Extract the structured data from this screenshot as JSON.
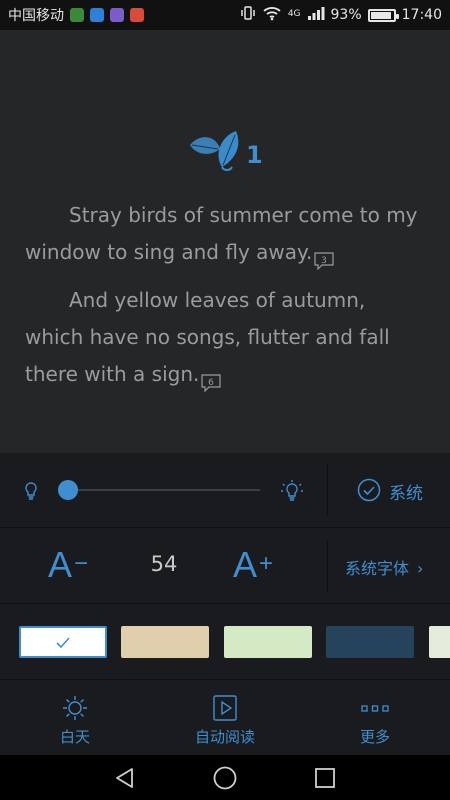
{
  "status_bar": {
    "carrier": "中国移动",
    "signal_type": "4G",
    "battery": "93%",
    "battery_level": 0.93,
    "time": "17:40"
  },
  "reader": {
    "chapter_number": "1",
    "paragraphs": [
      "Stray birds of summer come to my window to sing and fly away.",
      "And yellow leaves of autumn, which have no songs, flutter and fall there with a sign."
    ],
    "note_counts": [
      "3",
      "6"
    ]
  },
  "settings": {
    "brightness_level": 0.02,
    "system_brightness_label": "系统",
    "font_decrease_label": "A",
    "font_increase_label": "A",
    "font_size": "54",
    "system_font_label": "系统字体",
    "themes": [
      {
        "name": "white",
        "color": "#ffffff",
        "selected": true
      },
      {
        "name": "beige",
        "color": "#dfcfac",
        "selected": false
      },
      {
        "name": "green",
        "color": "#d3eac4",
        "selected": false
      },
      {
        "name": "navy",
        "color": "#25445c",
        "selected": false
      },
      {
        "name": "light-green",
        "color": "#e3ecd8",
        "selected": false
      }
    ]
  },
  "bottom_nav": [
    {
      "label": "白天",
      "icon": "sun-icon"
    },
    {
      "label": "自动阅读",
      "icon": "play-book-icon"
    },
    {
      "label": "更多",
      "icon": "more-dots-icon"
    }
  ],
  "colors": {
    "accent": "#3f8fd0",
    "reader_bg": "#252628",
    "panel_bg": "#1a1b1e"
  }
}
